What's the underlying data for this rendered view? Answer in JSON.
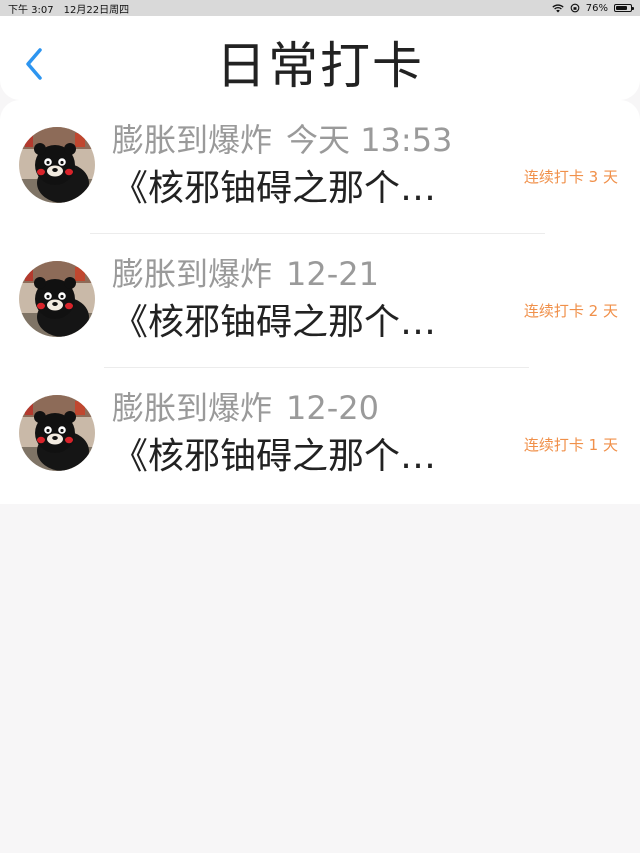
{
  "status_bar": {
    "time": "下午 3:07",
    "date": "12月22日周四",
    "battery": "76%",
    "battery_level": 0.76,
    "wifi_icon": "wifi-icon",
    "orientation_icon": "orientation-lock-icon"
  },
  "nav": {
    "back_icon": "chevron-left-icon",
    "title": "日常打卡"
  },
  "entries": [
    {
      "username": "膨胀到爆炸",
      "time": "今天 13:53",
      "content": "《核邪铀碍之那个…",
      "streak": "连续打卡 3 天"
    },
    {
      "username": "膨胀到爆炸",
      "time": "12-21",
      "content": "《核邪铀碍之那个…",
      "streak": "连续打卡 2 天"
    },
    {
      "username": "膨胀到爆炸",
      "time": "12-20",
      "content": "《核邪铀碍之那个…",
      "streak": "连续打卡 1 天"
    }
  ],
  "colors": {
    "accent_blue": "#2d95f0",
    "streak_orange": "#f0904a",
    "username_gray": "#9a9a9a"
  }
}
